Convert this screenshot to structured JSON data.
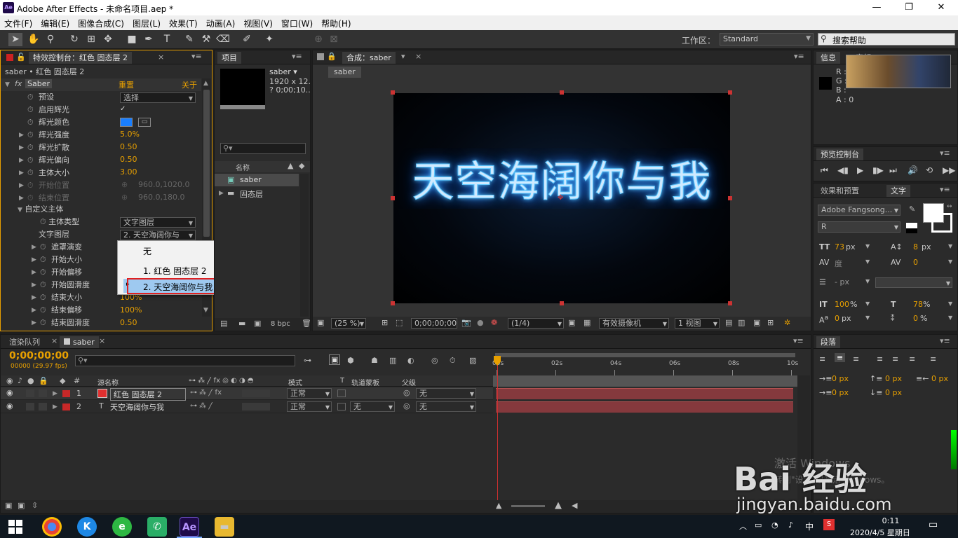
{
  "window": {
    "title": "Adobe After Effects - 未命名项目.aep *",
    "logo": "Ae"
  },
  "menu": [
    "文件(F)",
    "编辑(E)",
    "图像合成(C)",
    "图层(L)",
    "效果(T)",
    "动画(A)",
    "视图(V)",
    "窗口(W)",
    "帮助(H)"
  ],
  "toolbar": {
    "workspace_label": "工作区：",
    "workspace_value": "Standard",
    "search_placeholder": "搜索帮助"
  },
  "effects_panel": {
    "tab": "特效控制台：红色 固态层 2",
    "layer_path": "saber • 红色 固态层 2",
    "effect_name": "Saber",
    "reset": "重置",
    "about": "关于",
    "props": [
      {
        "label": "预设",
        "value": "选择"
      },
      {
        "label": "启用辉光",
        "value": "✓"
      },
      {
        "label": "辉光颜色",
        "value": ""
      },
      {
        "label": "辉光强度",
        "value": "5.0%"
      },
      {
        "label": "辉光扩散",
        "value": "0.50"
      },
      {
        "label": "辉光偏向",
        "value": "0.50"
      },
      {
        "label": "主体大小",
        "value": "3.00"
      },
      {
        "label": "开始位置",
        "value": "960.0,1020.0"
      },
      {
        "label": "结束位置",
        "value": "960.0,180.0"
      }
    ],
    "custom_body": "自定义主体",
    "body_type_label": "主体类型",
    "body_type_value": "文字图层",
    "text_layer_label": "文字图层",
    "text_layer_value": "2. 天空海阔你与",
    "sub_props": [
      {
        "label": "遮罩演变",
        "value": ""
      },
      {
        "label": "开始大小",
        "value": ""
      },
      {
        "label": "开始偏移",
        "value": ""
      },
      {
        "label": "开始圆滑度",
        "value": ""
      },
      {
        "label": "结束大小",
        "value": "100%"
      },
      {
        "label": "结束偏移",
        "value": "100%"
      },
      {
        "label": "结束圆滑度",
        "value": "0.50"
      }
    ],
    "dropdown": [
      "无",
      "1. 红色 固态层 2",
      "2. 天空海阔你与我"
    ]
  },
  "project_panel": {
    "tab": "项目",
    "comp_name": "saber ▾",
    "comp_info1": "1920 x 12...",
    "comp_info2": "? 0;00;10...",
    "name_header": "名称",
    "items": [
      "saber",
      "固态层"
    ],
    "bpc": "8 bpc"
  },
  "comp_panel": {
    "tab": "合成：saber",
    "subtab": "saber",
    "text": "天空海阔你与我",
    "zoom": "(25 %)",
    "timecode": "0;00;00;00",
    "resolution": "(1/4)",
    "camera": "有效摄像机",
    "view": "1 视图"
  },
  "info_panel": {
    "tab": "信息",
    "tab2": "音频",
    "r": "R :",
    "g": "G :",
    "b": "B :",
    "a": "A : 0"
  },
  "preview_panel": {
    "tab": "预览控制台"
  },
  "text_panel": {
    "tab1": "效果和预置",
    "tab2": "文字",
    "font": "Adobe Fangsong...",
    "style": "R",
    "size": "73",
    "size_unit": "px",
    "leading": "8",
    "leading_unit": "px",
    "kerning": "度",
    "tracking": "0",
    "stroke": "- px",
    "vscale": "100",
    "vscale_unit": "%",
    "hscale": "78",
    "hscale_unit": "%",
    "baseline": "0",
    "baseline_unit": "px",
    "tsume": "0",
    "tsume_unit": "%"
  },
  "paragraph_panel": {
    "tab": "段落",
    "v1": "0 px",
    "v2": "0 px",
    "v3": "0 px",
    "v4": "0 px",
    "v5": "0 px"
  },
  "timeline": {
    "tab1": "渲染队列",
    "tab2": "saber",
    "timecode": "0;00;00;00",
    "fps": "00000 (29.97 fps)",
    "col_source": "源名称",
    "col_mode": "模式",
    "col_t": "T",
    "col_track": "轨道蒙板",
    "col_parent": "父级",
    "ruler": [
      "00s",
      "02s",
      "04s",
      "06s",
      "08s",
      "10s"
    ],
    "layers": [
      {
        "num": "1",
        "name": "红色 固态层 2",
        "mode": "正常",
        "track": "",
        "parent": "无"
      },
      {
        "num": "2",
        "name": "天空海阔你与我",
        "mode": "正常",
        "track": "无",
        "parent": "无"
      }
    ]
  },
  "watermark": {
    "line1": "激活 Windows",
    "line2": "转到\"设置\"以激活 Windows。",
    "baidu": "Bai 经验",
    "url": "jingyan.baidu.com"
  },
  "taskbar": {
    "time": "0:11",
    "date": "2020/4/5 星期日",
    "ime": "中"
  },
  "colors": {
    "accent_orange": "#e8a000",
    "glow_blue": "#5fc8ff",
    "layer_red": "#d83030",
    "selection_blue": "#9ec9f0"
  }
}
